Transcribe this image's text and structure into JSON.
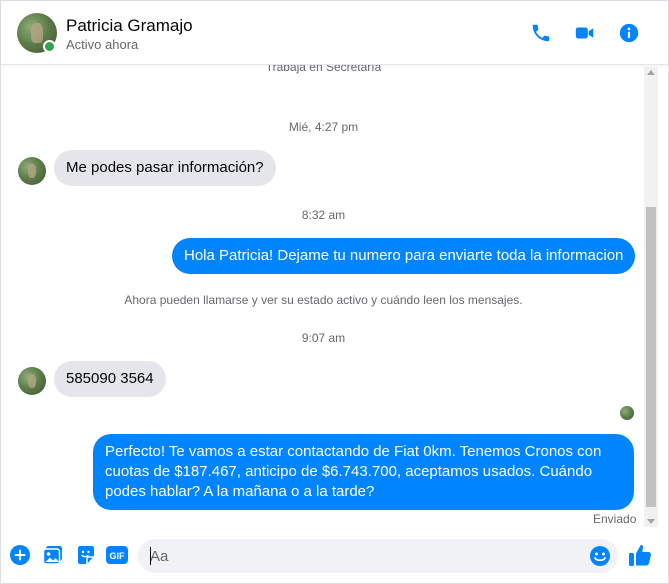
{
  "header": {
    "contact_name": "Patricia Gramajo",
    "status": "Activo ahora",
    "actions": [
      "phone-icon",
      "video-icon",
      "info-icon"
    ]
  },
  "messages": {
    "cut_text": "Trabaja en Secretaría",
    "ts1": "Mié, 4:27 pm",
    "msg1": "Me podes pasar información?",
    "ts2": "8:32 am",
    "msg2": "Hola Patricia! Dejame tu numero para enviarte toda la informacion",
    "notice": "Ahora pueden llamarse y ver su estado activo y cuándo leen los mensajes.",
    "ts3": "9:07 am",
    "msg3": "585090 3564",
    "msg4": "Perfecto! Te vamos a estar contactando de Fiat 0km. Tenemos Cronos con cuotas de $187.467, anticipo de $6.743.700, aceptamos usados. Cuándo podes hablar? A la mañana o a la tarde?",
    "sent_status": "Enviado"
  },
  "composer": {
    "placeholder": "Aa",
    "gif_label": "GIF"
  },
  "colors": {
    "accent": "#0084ff",
    "incoming_bubble": "#e4e6eb",
    "online": "#31a24c"
  }
}
